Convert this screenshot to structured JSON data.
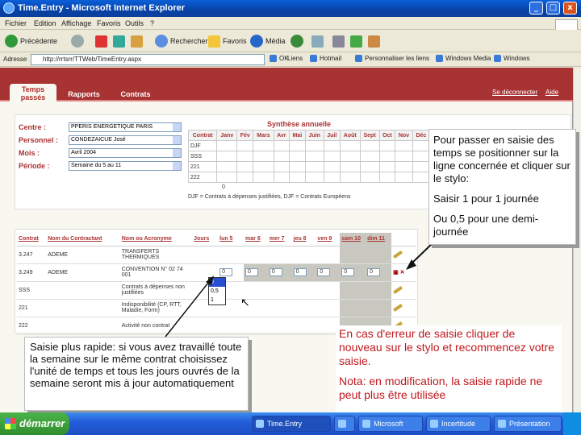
{
  "window": {
    "title": "Time.Entry - Microsoft Internet Explorer",
    "minimize": "_",
    "maximize": "□",
    "close": "x"
  },
  "menu": [
    "Fichier",
    "Edition",
    "Affichage",
    "Favoris",
    "Outils",
    "?"
  ],
  "toolbar": {
    "back": "Précédente",
    "search": "Rechercher",
    "favorites": "Favoris",
    "media": "Média"
  },
  "address": {
    "label": "Adresse",
    "url": "http://rrtsrr/TTWeb/TimeEntry.aspx",
    "go": "OK",
    "links": [
      "Liens",
      "Hotmail",
      "Personnaliser les liens",
      "Windows Media",
      "Windows"
    ]
  },
  "app": {
    "tabs": [
      "Temps passés",
      "Rapports",
      "Contrats"
    ],
    "header_links": [
      "Se déconnecter",
      "Aide"
    ]
  },
  "form": {
    "labels": [
      "Centre :",
      "Personnel :",
      "Mois :",
      "Période :"
    ],
    "values": [
      "PPERIS ENERGETIQUE PARIS",
      "CONDEZAICUE José",
      "Avril 2004",
      "Semaine du 5 au 11"
    ]
  },
  "synthese": {
    "title": "Synthèse annuelle",
    "header": [
      "Contrat",
      "Janv",
      "Fév",
      "Mars",
      "Avr",
      "Mai",
      "Juin",
      "Juil",
      "Août",
      "Sept",
      "Oct",
      "Nov",
      "Déc"
    ],
    "rows": [
      "DJF",
      "SSS",
      "221",
      "222"
    ],
    "legend_value": "0",
    "legend": "DJF = Contrats à dépenses justifiées, DJF = Contrats Européens"
  },
  "entry_table": {
    "headers": [
      "Contrat",
      "Nom du Contractant",
      "Nom ou Acronyme",
      "Jours",
      "lun 5",
      "mar 6",
      "mer 7",
      "jeu 8",
      "ven 9",
      "sam 10",
      "dim 11"
    ],
    "rows": [
      {
        "contrat": "3.247",
        "contractant": "ADEME",
        "acronyme": "TRANSFERTS THERMIQUES"
      },
      {
        "contrat": "3.249",
        "contractant": "ADEME",
        "acronyme": "CONVENTION N° 02 74 001"
      },
      {
        "contrat": "SSS",
        "contractant": "",
        "acronyme": "Contrats à dépenses non justifiées"
      },
      {
        "contrat": "221",
        "contractant": "",
        "acronyme": "Indisponibilité (CP, RTT, Maladie, Form)"
      },
      {
        "contrat": "222",
        "contractant": "",
        "acronyme": "Activité non contrat"
      }
    ],
    "row2_values": [
      "0",
      "0",
      "0",
      "0",
      "0",
      "0",
      "0"
    ],
    "dropdown_options": [
      "0",
      "0,5",
      "1"
    ]
  },
  "callouts": {
    "right": [
      "Pour passer en saisie des temps se positionner sur la ligne concernée et cliquer sur le stylo:",
      "Saisir 1 pour 1 journée",
      "Ou 0,5 pour une demi-journée"
    ],
    "left": "Saisie plus rapide: si vous avez travaillé toute la semaine sur le même contrat choisissez l'unité de temps et tous les jours ouvrés de la semaine seront mis à jour automatiquement",
    "center": [
      "En cas d'erreur de saisie cliquer de nouveau sur le stylo et recommencez votre saisie.",
      "Nota: en modification, la saisie rapide ne peut plus être utilisée"
    ]
  },
  "taskbar": {
    "start": "démarrer",
    "tasks": [
      "Time.Entry",
      "",
      "Microsoft",
      "Incertitude",
      "Présentation"
    ]
  },
  "colors": {
    "header_bar": "#a83333",
    "accent_red": "#c0181d",
    "xp_blue": "#245edb"
  }
}
